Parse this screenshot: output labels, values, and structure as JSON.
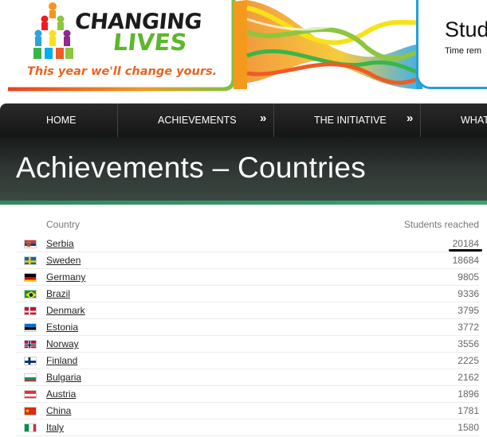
{
  "header": {
    "logo_line1": "CHANGING",
    "logo_line2": "LIVES",
    "tagline": "This year we'll change yours.",
    "title": "Stud",
    "subtitle": "Time rem"
  },
  "nav": {
    "items": [
      {
        "label": "HOME"
      },
      {
        "label": "ACHIEVEMENTS"
      },
      {
        "label": "THE INITIATIVE"
      },
      {
        "label": "WHAT"
      }
    ],
    "chevron": "»"
  },
  "page": {
    "title": "Achievements – Countries"
  },
  "table": {
    "headers": {
      "country": "Country",
      "students": "Students reached"
    },
    "rows": [
      {
        "country": "Serbia",
        "students": "20184",
        "flag": "serbia-flag-icon"
      },
      {
        "country": "Sweden",
        "students": "18684",
        "flag": "sweden-flag-icon"
      },
      {
        "country": "Germany",
        "students": "9805",
        "flag": "germany-flag-icon"
      },
      {
        "country": "Brazil",
        "students": "9336",
        "flag": "brazil-flag-icon"
      },
      {
        "country": "Denmark",
        "students": "3795",
        "flag": "denmark-flag-icon"
      },
      {
        "country": "Estonia",
        "students": "3772",
        "flag": "estonia-flag-icon"
      },
      {
        "country": "Norway",
        "students": "3556",
        "flag": "norway-flag-icon"
      },
      {
        "country": "Finland",
        "students": "2225",
        "flag": "finland-flag-icon"
      },
      {
        "country": "Bulgaria",
        "students": "2162",
        "flag": "bulgaria-flag-icon"
      },
      {
        "country": "Austria",
        "students": "1896",
        "flag": "austria-flag-icon"
      },
      {
        "country": "China",
        "students": "1781",
        "flag": "china-flag-icon"
      },
      {
        "country": "Italy",
        "students": "1580",
        "flag": "italy-flag-icon"
      }
    ]
  },
  "colors": {
    "nav_bg": "#1e1e1e",
    "accent_green": "#3aa36f",
    "logo_green": "#5cb82a",
    "logo_orange": "#e8631d",
    "header_blue": "#1fa0dc"
  }
}
